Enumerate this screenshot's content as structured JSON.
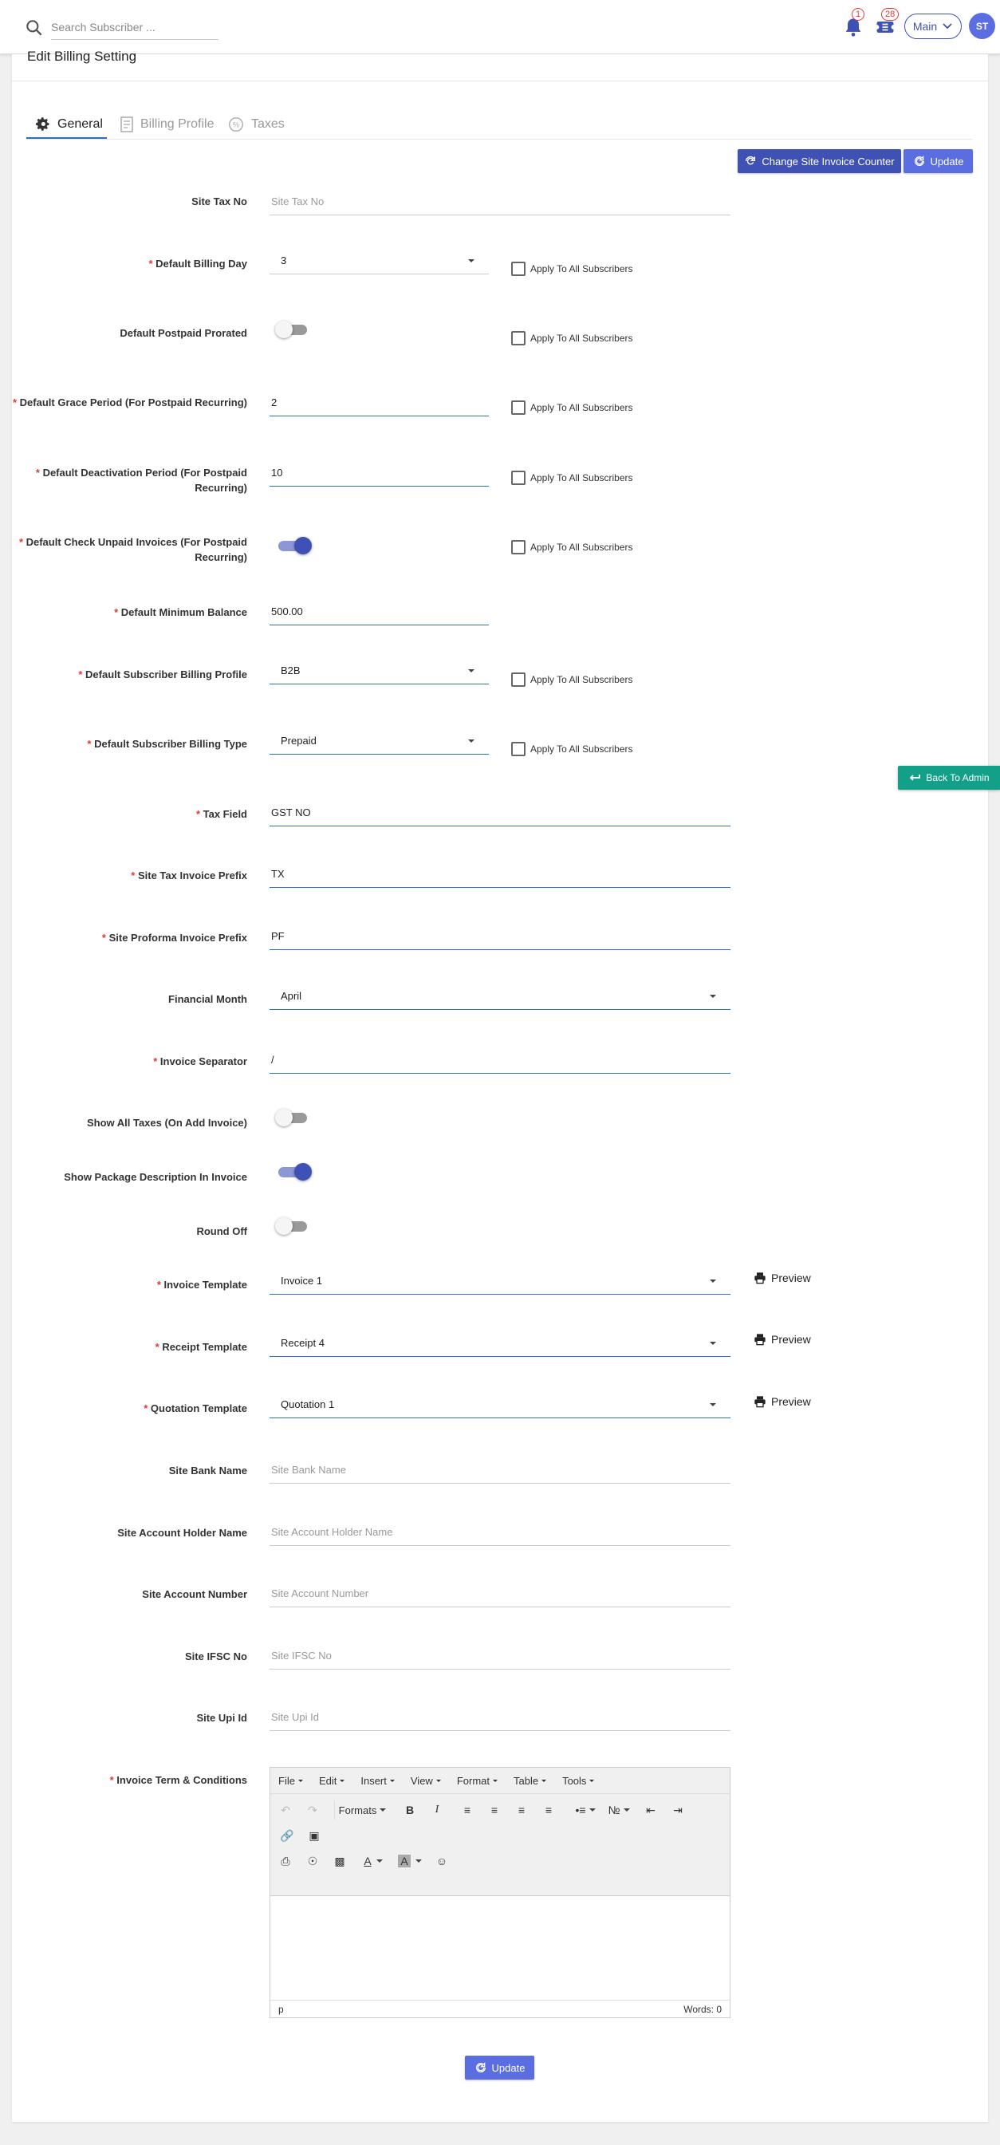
{
  "topbar": {
    "search_placeholder": "Search Subscriber ...",
    "notifications_count": "1",
    "tickets_count": "28",
    "main_label": "Main",
    "avatar_initials": "ST"
  },
  "page": {
    "title": "Edit Billing Setting",
    "tabs": [
      {
        "label": "General",
        "icon": "gear-icon",
        "active": true
      },
      {
        "label": "Billing Profile",
        "icon": "receipt-icon",
        "active": false
      },
      {
        "label": "Taxes",
        "icon": "tax-icon",
        "active": false
      }
    ],
    "change_counter_label": "Change Site Invoice Counter",
    "update_label": "Update",
    "apply_all_label": "Apply To All Subscribers",
    "preview_label": "Preview",
    "back_to_admin_label": "Back To Admin"
  },
  "fields": {
    "site_tax_no": {
      "label": "Site Tax No",
      "placeholder": "Site Tax No"
    },
    "default_billing_day": {
      "label": "Default Billing Day",
      "value": "3"
    },
    "default_postpaid_prorated": {
      "label": "Default Postpaid Prorated",
      "on": false
    },
    "default_grace_period": {
      "label": "Default Grace Period (For Postpaid Recurring)",
      "value": "2"
    },
    "default_deactivation_period": {
      "label": "Default Deactivation Period (For Postpaid Recurring)",
      "value": "10"
    },
    "default_check_unpaid": {
      "label": "Default Check Unpaid Invoices (For Postpaid Recurring)",
      "on": true
    },
    "default_minimum_balance": {
      "label": "Default Minimum Balance",
      "value": "500.00"
    },
    "default_subscriber_billing_profile": {
      "label": "Default Subscriber Billing Profile",
      "value": "B2B"
    },
    "default_subscriber_billing_type": {
      "label": "Default Subscriber Billing Type",
      "value": "Prepaid"
    },
    "tax_field": {
      "label": "Tax Field",
      "value": "GST NO"
    },
    "site_tax_invoice_prefix": {
      "label": "Site Tax Invoice Prefix",
      "value": "TX"
    },
    "site_proforma_invoice_prefix": {
      "label": "Site Proforma Invoice Prefix",
      "value": "PF"
    },
    "financial_month": {
      "label": "Financial Month",
      "value": "April"
    },
    "invoice_separator": {
      "label": "Invoice Separator",
      "value": "/"
    },
    "show_all_taxes": {
      "label": "Show All Taxes (On Add Invoice)",
      "on": false
    },
    "show_package_description": {
      "label": "Show Package Description In Invoice",
      "on": true
    },
    "round_off": {
      "label": "Round Off",
      "on": false
    },
    "invoice_template": {
      "label": "Invoice Template",
      "value": "Invoice 1"
    },
    "receipt_template": {
      "label": "Receipt Template",
      "value": "Receipt 4"
    },
    "quotation_template": {
      "label": "Quotation Template",
      "value": "Quotation 1"
    },
    "site_bank_name": {
      "label": "Site Bank Name",
      "placeholder": "Site Bank Name"
    },
    "site_account_holder_name": {
      "label": "Site Account Holder Name",
      "placeholder": "Site Account Holder Name"
    },
    "site_account_number": {
      "label": "Site Account Number",
      "placeholder": "Site Account Number"
    },
    "site_ifsc_no": {
      "label": "Site IFSC No",
      "placeholder": "Site IFSC No"
    },
    "site_upi_id": {
      "label": "Site Upi Id",
      "placeholder": "Site Upi Id"
    },
    "invoice_terms": {
      "label": "Invoice Term & Conditions"
    }
  },
  "editor": {
    "menus": [
      "File",
      "Edit",
      "Insert",
      "View",
      "Format",
      "Table",
      "Tools"
    ],
    "formats_label": "Formats",
    "path": "p",
    "word_count": "Words: 0"
  },
  "colors": {
    "primary": "#3f51b5",
    "update": "#5b6ee1",
    "back_admin": "#13a089",
    "required": "#e53935"
  }
}
